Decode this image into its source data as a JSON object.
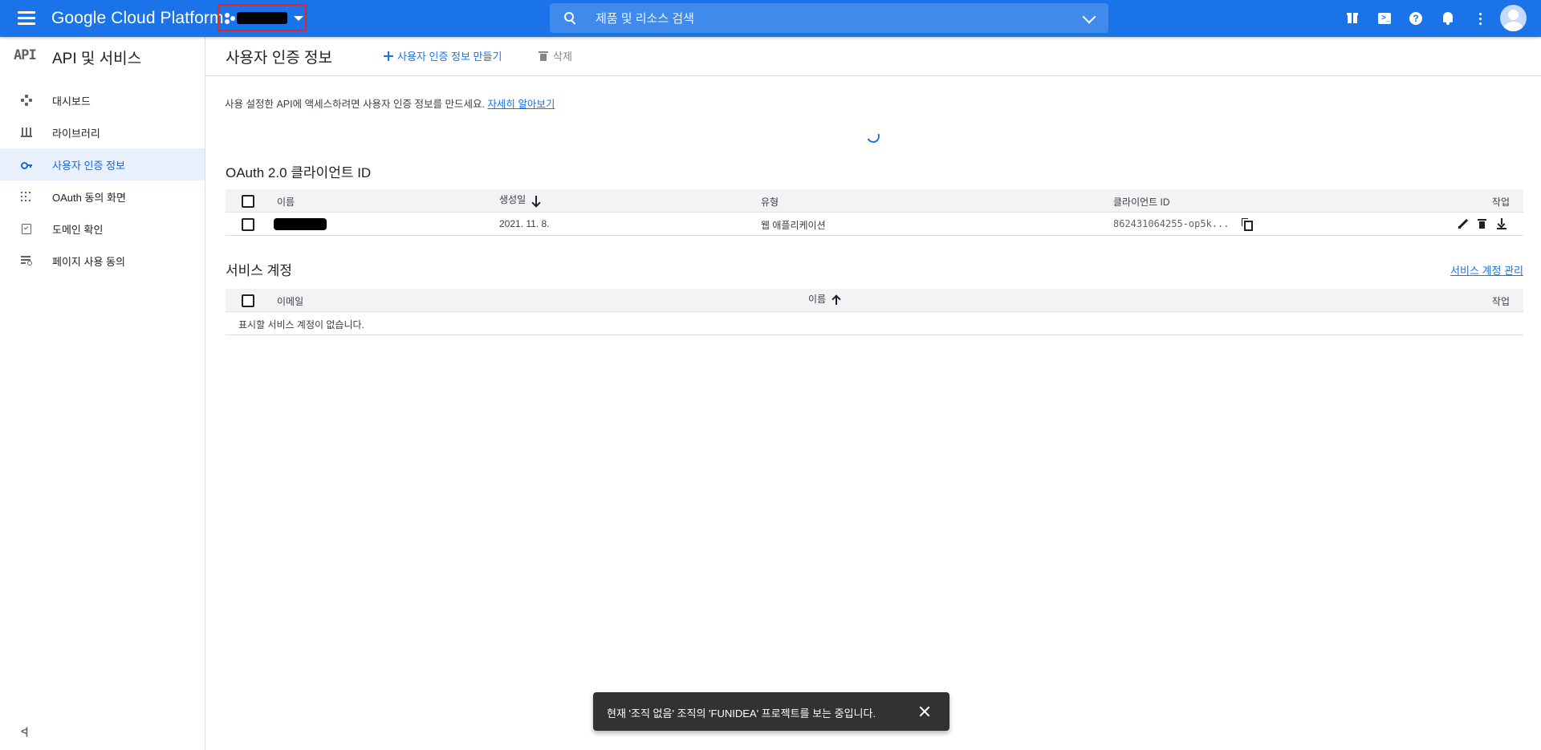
{
  "topbar": {
    "brand": "Google Cloud Platform",
    "search_placeholder": "제품 및 리소스 검색"
  },
  "sidebar": {
    "title": "API 및 서비스",
    "logo_text": "API",
    "items": [
      {
        "label": "대시보드",
        "icon": "dashboard-icon"
      },
      {
        "label": "라이브러리",
        "icon": "library-icon"
      },
      {
        "label": "사용자 인증 정보",
        "icon": "key-icon",
        "active": true
      },
      {
        "label": "OAuth 동의 화면",
        "icon": "oauth-consent-icon"
      },
      {
        "label": "도메인 확인",
        "icon": "domain-check-icon"
      },
      {
        "label": "페이지 사용 동의",
        "icon": "page-consent-icon"
      }
    ],
    "collapse_label": "<|"
  },
  "header": {
    "title": "사용자 인증 정보",
    "create_label": "사용자 인증 정보 만들기",
    "delete_label": "삭제"
  },
  "intro": {
    "text": "사용 설정한 API에 액세스하려면 사용자 인증 정보를 만드세요.",
    "link": "자세히 알아보기"
  },
  "oauth": {
    "title": "OAuth 2.0 클라이언트 ID",
    "columns": [
      "이름",
      "생성일",
      "유형",
      "클라이언트 ID",
      "작업"
    ],
    "rows": [
      {
        "created": "2021. 11. 8.",
        "type": "웹 애플리케이션",
        "client_id": "862431064255-op5k..."
      }
    ]
  },
  "service_accounts": {
    "title": "서비스 계정",
    "manage_link": "서비스 계정 관리",
    "columns": [
      "이메일",
      "이름",
      "작업"
    ],
    "empty_text": "표시할 서비스 계정이 없습니다."
  },
  "snackbar": {
    "text": "현재 '조직 없음' 조직의 'FUNIDEA' 프로젝트를 보는 중입니다."
  },
  "colors": {
    "brand_blue": "#1a73e8",
    "active_nav_bg": "#e8f0fe",
    "highlight_border": "#e8261f"
  }
}
